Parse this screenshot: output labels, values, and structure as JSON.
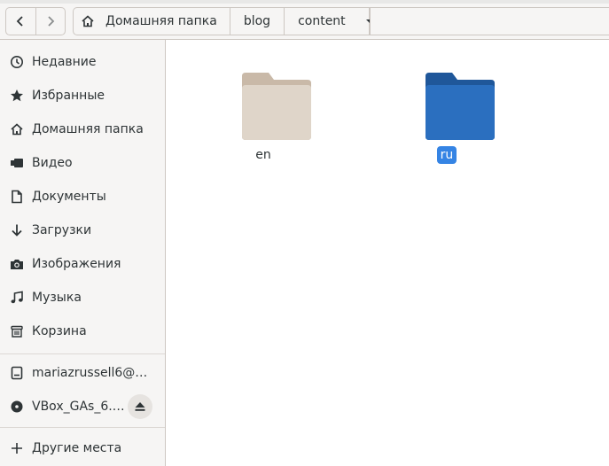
{
  "toolbar": {
    "back_icon": "chevron-left-icon",
    "forward_icon": "chevron-right-icon",
    "breadcrumbs": [
      "Домашняя папка",
      "blog",
      "content"
    ]
  },
  "sidebar": {
    "places": [
      {
        "label": "Недавние",
        "icon": "clock-icon"
      },
      {
        "label": "Избранные",
        "icon": "star-icon"
      },
      {
        "label": "Домашняя папка",
        "icon": "home-icon"
      },
      {
        "label": "Видео",
        "icon": "video-icon"
      },
      {
        "label": "Документы",
        "icon": "document-icon"
      },
      {
        "label": "Загрузки",
        "icon": "download-icon"
      },
      {
        "label": "Изображения",
        "icon": "camera-icon"
      },
      {
        "label": "Музыка",
        "icon": "music-icon"
      },
      {
        "label": "Корзина",
        "icon": "trash-icon"
      }
    ],
    "devices": [
      {
        "label": "mariazrussell6@…",
        "icon": "network-icon"
      },
      {
        "label": "VBox_GAs_6.…",
        "icon": "disc-icon"
      }
    ],
    "other": {
      "label": "Другие места",
      "icon": "plus-icon"
    }
  },
  "files": [
    {
      "name": "en",
      "selected": false,
      "color": "#dfd5c9"
    },
    {
      "name": "ru",
      "selected": true,
      "color": "#2b6fbf"
    }
  ],
  "colors": {
    "accent": "#3584e4",
    "folder_default": "#dfd5c9",
    "folder_selected": "#2b6fbf"
  }
}
